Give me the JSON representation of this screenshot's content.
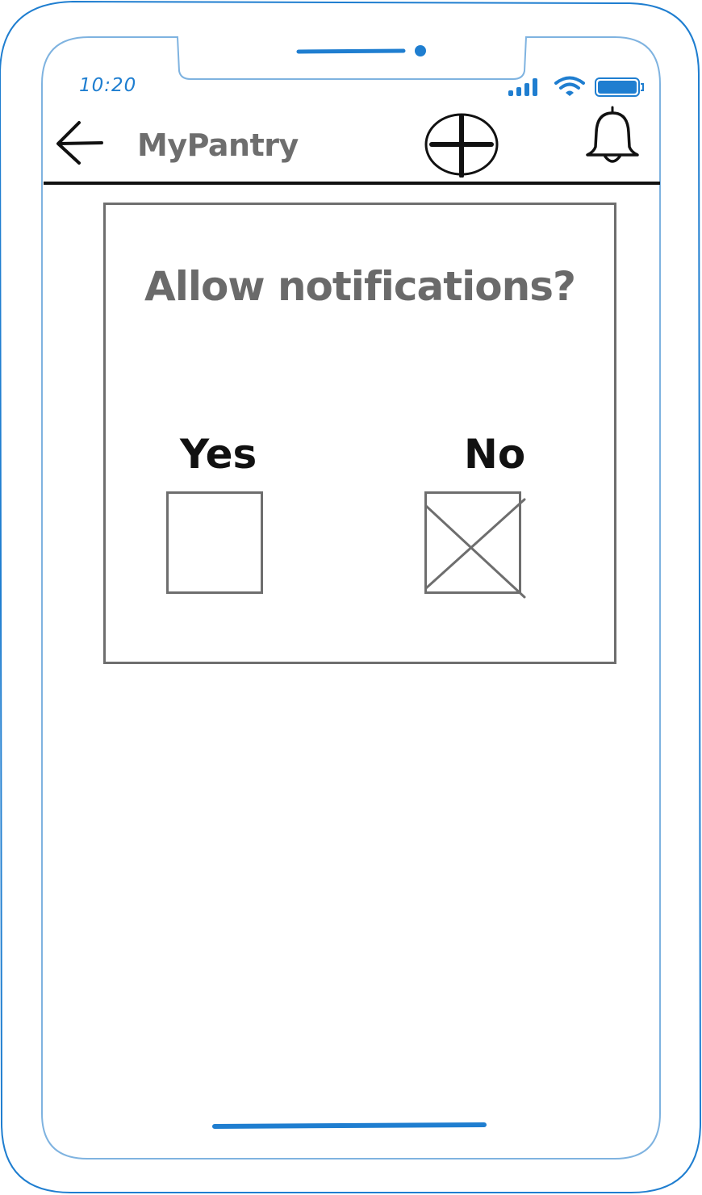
{
  "status_bar": {
    "time": "10:20",
    "icons": [
      "signal-icon",
      "wifi-icon",
      "battery-icon"
    ]
  },
  "header": {
    "back_icon": "arrow-left-icon",
    "title": "MyPantry",
    "add_icon": "plus-circle-icon",
    "notification_icon": "bell-icon"
  },
  "dialog": {
    "title": "Allow notifications?",
    "options": [
      {
        "label": "Yes",
        "checked": false
      },
      {
        "label": "No",
        "checked": true
      }
    ]
  },
  "colors": {
    "device_outline": "#1f7ed0",
    "device_inner_outline": "#7fb3e0",
    "wireframe_gray": "#6e6e6e",
    "ink": "#111111"
  }
}
